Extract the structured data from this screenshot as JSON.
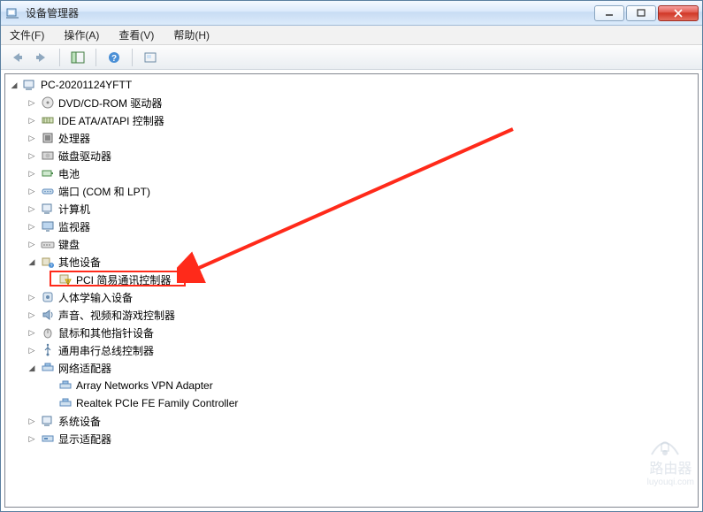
{
  "window": {
    "title": "设备管理器"
  },
  "menu": {
    "file": "文件(F)",
    "action": "操作(A)",
    "view": "查看(V)",
    "help": "帮助(H)"
  },
  "tree": {
    "root": "PC-20201124YFTT",
    "dvd": "DVD/CD-ROM 驱动器",
    "ide": "IDE ATA/ATAPI 控制器",
    "cpu": "处理器",
    "disk": "磁盘驱动器",
    "battery": "电池",
    "ports": "端口 (COM 和 LPT)",
    "computer": "计算机",
    "monitor": "监视器",
    "keyboard": "键盘",
    "other": "其他设备",
    "pci": "PCI 简易通讯控制器",
    "hid": "人体学输入设备",
    "sound": "声音、视频和游戏控制器",
    "mouse": "鼠标和其他指针设备",
    "usb": "通用串行总线控制器",
    "net": "网络适配器",
    "net1": "Array Networks VPN Adapter",
    "net2": "Realtek PCIe FE Family Controller",
    "system": "系统设备",
    "display": "显示适配器"
  },
  "watermark": {
    "text": "路由器",
    "sub": "luyouqi.com"
  }
}
